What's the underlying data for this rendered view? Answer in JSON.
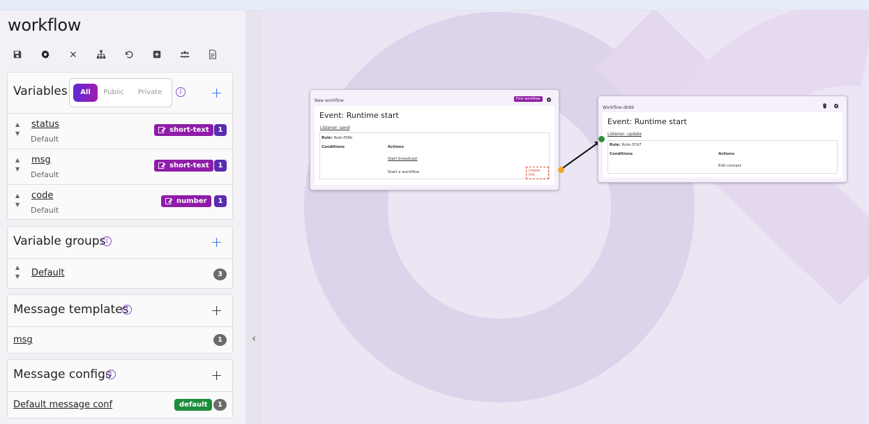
{
  "app": {
    "title": "workflow"
  },
  "toolbar": [
    "save-icon",
    "gear-icon",
    "close-icon",
    "hierarchy-icon",
    "undo-icon",
    "add-box-icon",
    "users-icon",
    "document-icon"
  ],
  "variables": {
    "title": "Variables",
    "filters": [
      "All",
      "Public",
      "Private"
    ],
    "active_filter": "All",
    "items": [
      {
        "name": "status",
        "sub": "Default",
        "type": "short-text",
        "count": "1"
      },
      {
        "name": "msg",
        "sub": "Default",
        "type": "short-text",
        "count": "1"
      },
      {
        "name": "code",
        "sub": "Default",
        "type": "number",
        "count": "1"
      }
    ]
  },
  "variable_groups": {
    "title": "Variable groups",
    "items": [
      {
        "name": "Default",
        "count": "3"
      }
    ]
  },
  "message_templates": {
    "title": "Message templates",
    "items": [
      {
        "name": "msg",
        "count": "1"
      }
    ]
  },
  "message_configs": {
    "title": "Message configs",
    "items": [
      {
        "name": "Default message conf",
        "badge": "default",
        "count": "1"
      }
    ]
  },
  "canvas": {
    "nodes": [
      {
        "header": "New workflow",
        "badge": "First workflow",
        "event": "Event: Runtime start",
        "listener": "Listener: send",
        "rule_label": "Rule:",
        "rule_id": "Rule-f59b",
        "conditions_label": "Conditions",
        "actions_label": "Actions",
        "actions": [
          "Start broadcast",
          "Start a workflow"
        ],
        "delete_link": "Delete link"
      },
      {
        "header": "Workflow-db89",
        "event": "Event: Runtime start",
        "listener": "Listener: update",
        "rule_label": "Rule:",
        "rule_id": "Rule-37d7",
        "conditions_label": "Conditions",
        "actions_label": "Actions",
        "actions": [
          "Edit contact"
        ]
      }
    ]
  },
  "colors": {
    "accent_purple": "#8e1ca8",
    "count_purple": "#5a2bb0",
    "plus_blue": "#2a6be8",
    "default_green": "#1c8c3a",
    "output_handle": "#f5a623",
    "input_handle": "#2e8b3e"
  }
}
